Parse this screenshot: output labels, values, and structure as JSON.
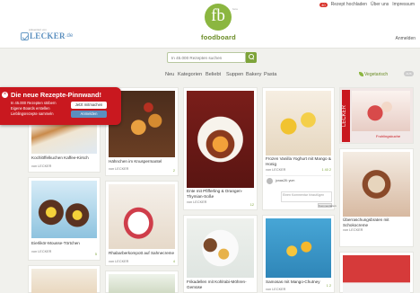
{
  "header": {
    "presented_by": "präsentiert von",
    "partner_name": "LECKER",
    "partner_tld": ".de",
    "logo_text": "fb",
    "beta": "beta",
    "brand": "foodboard",
    "count": "40",
    "links": [
      "Rezept hochladen",
      "Über uns",
      "Impressum"
    ],
    "anmelden": "Anmelden"
  },
  "search": {
    "placeholder": "In 45.000 Rezepten suchen"
  },
  "nav": {
    "items": [
      "Neu",
      "Kategorien",
      "Beliebt",
      "Suppen",
      "Bakery",
      "Pasta"
    ],
    "veg_label": "Vegetarisch",
    "toggle": "AUS"
  },
  "popup": {
    "title": "Die neue Rezepte-Pinnwand!",
    "lines": [
      "In 45.000 Rezepten stöbern",
      "Eigene Boards erstellen",
      "Lieblingsrezepte sammeln"
    ],
    "btn_primary": "Jetzt mitmachen",
    "btn_secondary": "Anmelden"
  },
  "cards": [
    {
      "title": "Kochlöffelkuchen Kaffee-Kirsch",
      "by": "von LECKER",
      "stats": ""
    },
    {
      "title": "Hähnchen im Knuspermantel",
      "by": "von LECKER",
      "stats": "2"
    },
    {
      "title": "Ente mit Pfifferling & Orangen-Thymian-Soße",
      "by": "von LECKER",
      "stats": "12"
    },
    {
      "title": "Frozen Vanilla Yoghurt mit Mango & Honig",
      "by": "von LECKER",
      "stats": "1  40  2"
    },
    {
      "title": "",
      "by": "",
      "stats": "",
      "magazine": "LECKER",
      "tagline": "Fruhlingskuche"
    },
    {
      "title": "Eierlikör-Mousse-Törtchen",
      "by": "von LECKER",
      "stats": "5"
    },
    {
      "title": "Rhabarberkompott auf Sahnecreme",
      "by": "von LECKER",
      "stats": "4"
    },
    {
      "title": "Überraschungsbraten mit Schokocreme",
      "by": "von LECKER",
      "stats": ""
    },
    {
      "title": "Frikadellen mit Kohlrabi-Möhren-Gemüse",
      "by": "von LECKER",
      "stats": "2"
    },
    {
      "title": "Samosas mit Mango-Chutney",
      "by": "von LECKER",
      "stats": "1  2"
    }
  ],
  "comment": {
    "user": "jonas28: yum",
    "placeholder": "Einen Kommentar hinzufügen",
    "button": "Kommentieren"
  }
}
